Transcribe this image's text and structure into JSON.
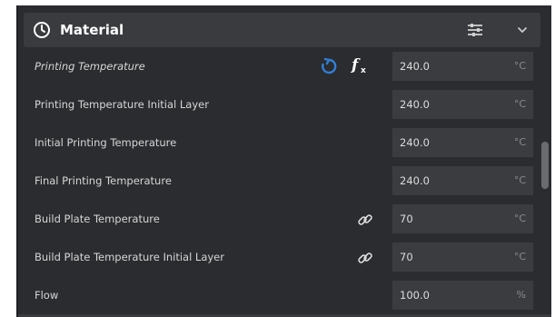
{
  "section": {
    "title": "Material",
    "icon": "material-icon",
    "settings_icon": "tune-icon",
    "collapse_icon": "chevron-down-icon"
  },
  "settings": [
    {
      "label": "Printing Temperature",
      "value": "240.0",
      "unit": "°C",
      "italic": true,
      "reset": true,
      "fx": true
    },
    {
      "label": "Printing Temperature Initial Layer",
      "value": "240.0",
      "unit": "°C"
    },
    {
      "label": "Initial Printing Temperature",
      "value": "240.0",
      "unit": "°C"
    },
    {
      "label": "Final Printing Temperature",
      "value": "240.0",
      "unit": "°C"
    },
    {
      "label": "Build Plate Temperature",
      "value": "70",
      "unit": "°C",
      "link": true
    },
    {
      "label": "Build Plate Temperature Initial Layer",
      "value": "70",
      "unit": "°C",
      "link": true
    },
    {
      "label": "Flow",
      "value": "100.0",
      "unit": "%"
    }
  ],
  "colors": {
    "background": "#2b2c2f",
    "header": "#3a3b3f",
    "field": "#3b3c40",
    "accent_blue": "#2f7fd6"
  }
}
